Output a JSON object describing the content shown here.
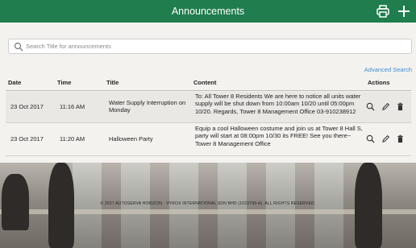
{
  "header": {
    "title": "Announcements"
  },
  "search": {
    "placeholder": "Search Title for announcements"
  },
  "advanced_search": "Advanced Search",
  "table": {
    "headers": {
      "date": "Date",
      "time": "Time",
      "title": "Title",
      "content": "Content",
      "actions": "Actions"
    },
    "rows": [
      {
        "date": "23 Oct 2017",
        "time": "11:16 AM",
        "title": "Water Supply Interruption on Monday",
        "content": "To: All Tower 8 Residents We are here to notice all units water supply will be shut down from 10:00am 10/20 until 05:00pm 10/20. Regards, Tower 8 Management Office 03-910238912"
      },
      {
        "date": "23 Oct 2017",
        "time": "11:20 AM",
        "title": "Halloween Party",
        "content": "Equip a cool Halloween costume and join us at Tower 8 Hall S, party will start at 08:00pm 10/30 its FREE! See you there~ Tower 8 Management Office"
      }
    ]
  },
  "footer": "© 2017 AUTOSERVA HORIZON · VYROX INTERNATIONAL SDN BHD (1023799-A). ALL RIGHTS RESERVED.",
  "colors": {
    "header_bg": "#1f7d4e",
    "link": "#3a8fd6"
  },
  "icons": {
    "print": "printer-icon",
    "add": "plus-icon",
    "search": "search-icon",
    "view": "magnifier-icon",
    "edit": "pencil-icon",
    "delete": "trash-icon"
  }
}
